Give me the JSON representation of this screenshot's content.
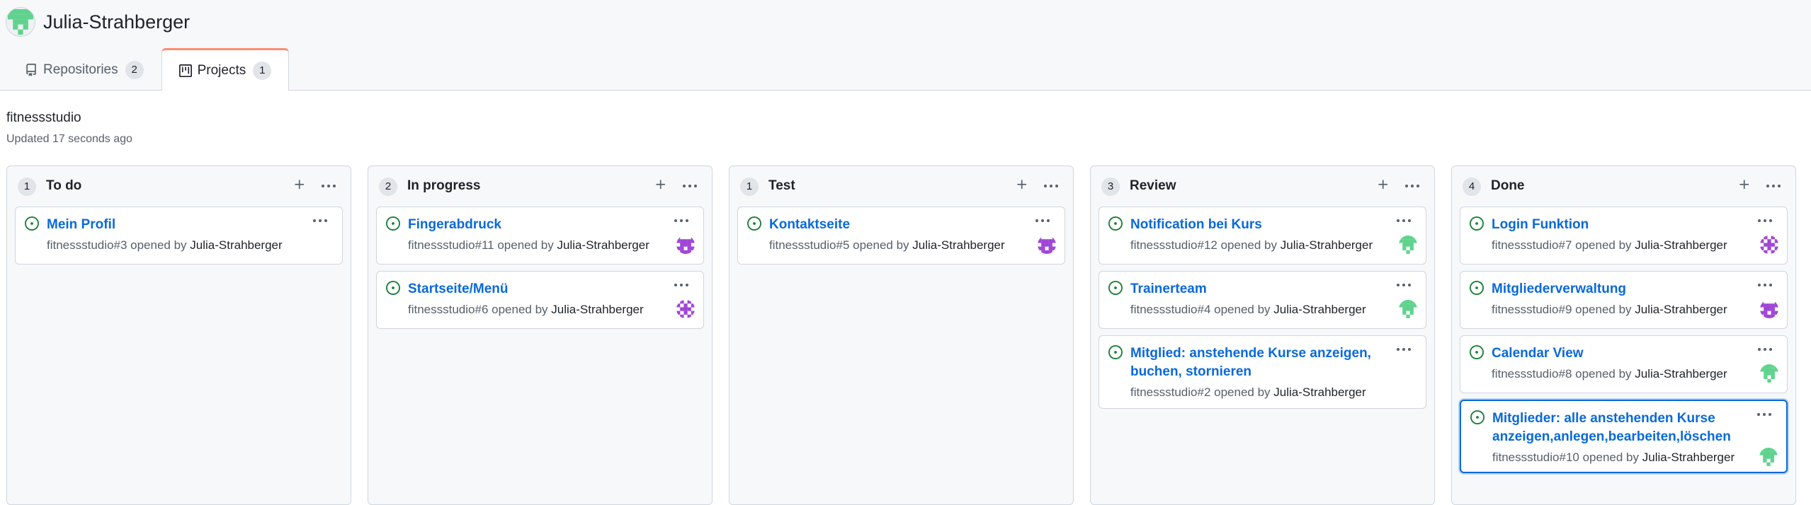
{
  "owner": {
    "name": "Julia-Strahberger",
    "avatar_icon": "identicon-green",
    "avatar_color": "#5fd38d"
  },
  "tabs": [
    {
      "label": "Repositories",
      "count": "2",
      "icon": "repo-icon"
    },
    {
      "label": "Projects",
      "count": "1",
      "icon": "project-icon",
      "selected": true
    }
  ],
  "project": {
    "title": "fitnessstudio",
    "updated": "Updated 17 seconds ago"
  },
  "columns": [
    {
      "name": "To do",
      "count": "1",
      "cards": [
        {
          "title": "Mein Profil",
          "ref": "fitnessstudio#3",
          "opened": " opened by ",
          "author": "Julia-Strahberger",
          "avatar": "none"
        }
      ]
    },
    {
      "name": "In progress",
      "count": "2",
      "cards": [
        {
          "title": "Fingerabdruck",
          "ref": "fitnessstudio#11",
          "opened": " opened by ",
          "author": "Julia-Strahberger",
          "avatar": "purple-a"
        },
        {
          "title": "Startseite/Menü",
          "ref": "fitnessstudio#6",
          "opened": " opened by ",
          "author": "Julia-Strahberger",
          "avatar": "purple-b"
        }
      ]
    },
    {
      "name": "Test",
      "count": "1",
      "cards": [
        {
          "title": "Kontaktseite",
          "ref": "fitnessstudio#5",
          "opened": " opened by ",
          "author": "Julia-Strahberger",
          "avatar": "purple-a"
        }
      ]
    },
    {
      "name": "Review",
      "count": "3",
      "cards": [
        {
          "title": "Notification bei Kurs",
          "ref": "fitnessstudio#12",
          "opened": " opened by ",
          "author": "Julia-Strahberger",
          "avatar": "green"
        },
        {
          "title": "Trainerteam",
          "ref": "fitnessstudio#4",
          "opened": " opened by ",
          "author": "Julia-Strahberger",
          "avatar": "green"
        },
        {
          "title": "Mitglied: anstehende Kurse anzeigen, buchen, stornieren",
          "ref": "fitnessstudio#2",
          "opened": " opened by ",
          "author": "Julia-Strahberger",
          "avatar": "none"
        }
      ]
    },
    {
      "name": "Done",
      "count": "4",
      "cards": [
        {
          "title": "Login Funktion",
          "ref": "fitnessstudio#7",
          "opened": " opened by ",
          "author": "Julia-Strahberger",
          "avatar": "purple-b"
        },
        {
          "title": "Mitgliederverwaltung",
          "ref": "fitnessstudio#9",
          "opened": " opened by ",
          "author": "Julia-Strahberger",
          "avatar": "purple-a"
        },
        {
          "title": "Calendar View",
          "ref": "fitnessstudio#8",
          "opened": " opened by ",
          "author": "Julia-Strahberger",
          "avatar": "green"
        },
        {
          "title": "Mitglieder: alle anstehenden Kurse anzeigen,anlegen,bearbeiten,löschen",
          "ref": "fitnessstudio#10",
          "opened": " opened by ",
          "author": "Julia-Strahberger",
          "avatar": "green",
          "focused": true
        }
      ]
    }
  ],
  "colors": {
    "link": "#0969da",
    "open_issue": "#1a7f37",
    "selected_tab_accent": "#fd8c73",
    "avatar_purple": "#a046d6",
    "avatar_green": "#5fd38d"
  }
}
